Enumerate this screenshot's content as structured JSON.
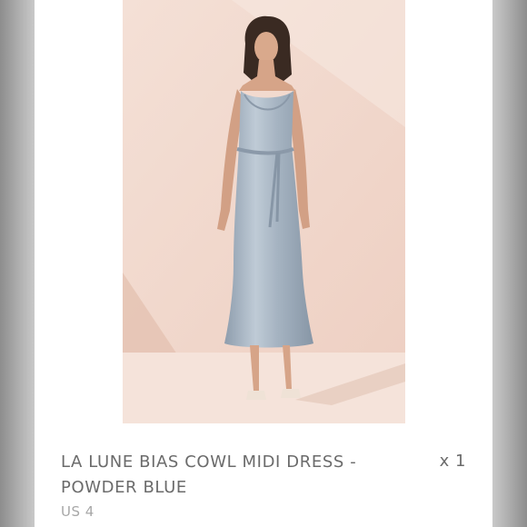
{
  "listing": {
    "title": "LA LUNE BIAS COWL MIDI DRESS - POWDER BLUE",
    "size": "US 4",
    "quantity": "x 1"
  },
  "photo": {
    "subject": "product-photo",
    "colors": {
      "wall": "#f2dbd0",
      "floor": "#f6e6de",
      "dress": "#aab8c6",
      "dress_shadow": "#8897a6",
      "hair": "#3a2a22",
      "skin": "#d9a98c"
    }
  },
  "colors": {
    "title": "#6b6b6b",
    "size": "#a7a7a7",
    "side_bars": "#a8a8a8"
  }
}
